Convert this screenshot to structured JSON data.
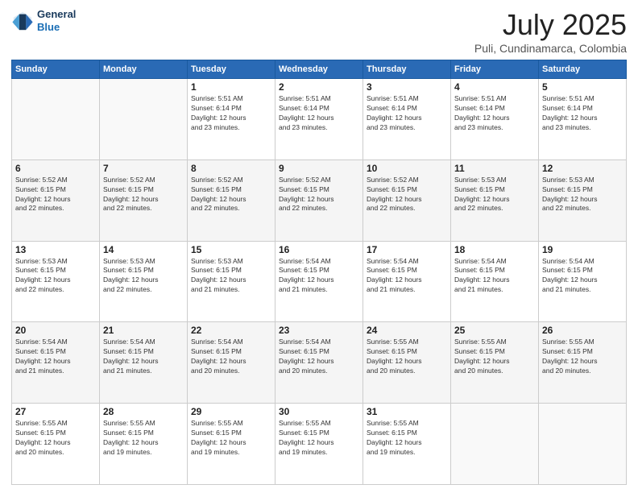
{
  "header": {
    "logo": {
      "line1": "General",
      "line2": "Blue"
    },
    "title": "July 2025",
    "subtitle": "Puli, Cundinamarca, Colombia"
  },
  "weekdays": [
    "Sunday",
    "Monday",
    "Tuesday",
    "Wednesday",
    "Thursday",
    "Friday",
    "Saturday"
  ],
  "weeks": [
    [
      {
        "day": "",
        "info": ""
      },
      {
        "day": "",
        "info": ""
      },
      {
        "day": "1",
        "sunrise": "5:51 AM",
        "sunset": "6:14 PM",
        "daylight": "12 hours and 23 minutes."
      },
      {
        "day": "2",
        "sunrise": "5:51 AM",
        "sunset": "6:14 PM",
        "daylight": "12 hours and 23 minutes."
      },
      {
        "day": "3",
        "sunrise": "5:51 AM",
        "sunset": "6:14 PM",
        "daylight": "12 hours and 23 minutes."
      },
      {
        "day": "4",
        "sunrise": "5:51 AM",
        "sunset": "6:14 PM",
        "daylight": "12 hours and 23 minutes."
      },
      {
        "day": "5",
        "sunrise": "5:51 AM",
        "sunset": "6:14 PM",
        "daylight": "12 hours and 23 minutes."
      }
    ],
    [
      {
        "day": "6",
        "sunrise": "5:52 AM",
        "sunset": "6:15 PM",
        "daylight": "12 hours and 22 minutes."
      },
      {
        "day": "7",
        "sunrise": "5:52 AM",
        "sunset": "6:15 PM",
        "daylight": "12 hours and 22 minutes."
      },
      {
        "day": "8",
        "sunrise": "5:52 AM",
        "sunset": "6:15 PM",
        "daylight": "12 hours and 22 minutes."
      },
      {
        "day": "9",
        "sunrise": "5:52 AM",
        "sunset": "6:15 PM",
        "daylight": "12 hours and 22 minutes."
      },
      {
        "day": "10",
        "sunrise": "5:52 AM",
        "sunset": "6:15 PM",
        "daylight": "12 hours and 22 minutes."
      },
      {
        "day": "11",
        "sunrise": "5:53 AM",
        "sunset": "6:15 PM",
        "daylight": "12 hours and 22 minutes."
      },
      {
        "day": "12",
        "sunrise": "5:53 AM",
        "sunset": "6:15 PM",
        "daylight": "12 hours and 22 minutes."
      }
    ],
    [
      {
        "day": "13",
        "sunrise": "5:53 AM",
        "sunset": "6:15 PM",
        "daylight": "12 hours and 22 minutes."
      },
      {
        "day": "14",
        "sunrise": "5:53 AM",
        "sunset": "6:15 PM",
        "daylight": "12 hours and 22 minutes."
      },
      {
        "day": "15",
        "sunrise": "5:53 AM",
        "sunset": "6:15 PM",
        "daylight": "12 hours and 21 minutes."
      },
      {
        "day": "16",
        "sunrise": "5:54 AM",
        "sunset": "6:15 PM",
        "daylight": "12 hours and 21 minutes."
      },
      {
        "day": "17",
        "sunrise": "5:54 AM",
        "sunset": "6:15 PM",
        "daylight": "12 hours and 21 minutes."
      },
      {
        "day": "18",
        "sunrise": "5:54 AM",
        "sunset": "6:15 PM",
        "daylight": "12 hours and 21 minutes."
      },
      {
        "day": "19",
        "sunrise": "5:54 AM",
        "sunset": "6:15 PM",
        "daylight": "12 hours and 21 minutes."
      }
    ],
    [
      {
        "day": "20",
        "sunrise": "5:54 AM",
        "sunset": "6:15 PM",
        "daylight": "12 hours and 21 minutes."
      },
      {
        "day": "21",
        "sunrise": "5:54 AM",
        "sunset": "6:15 PM",
        "daylight": "12 hours and 21 minutes."
      },
      {
        "day": "22",
        "sunrise": "5:54 AM",
        "sunset": "6:15 PM",
        "daylight": "12 hours and 20 minutes."
      },
      {
        "day": "23",
        "sunrise": "5:54 AM",
        "sunset": "6:15 PM",
        "daylight": "12 hours and 20 minutes."
      },
      {
        "day": "24",
        "sunrise": "5:55 AM",
        "sunset": "6:15 PM",
        "daylight": "12 hours and 20 minutes."
      },
      {
        "day": "25",
        "sunrise": "5:55 AM",
        "sunset": "6:15 PM",
        "daylight": "12 hours and 20 minutes."
      },
      {
        "day": "26",
        "sunrise": "5:55 AM",
        "sunset": "6:15 PM",
        "daylight": "12 hours and 20 minutes."
      }
    ],
    [
      {
        "day": "27",
        "sunrise": "5:55 AM",
        "sunset": "6:15 PM",
        "daylight": "12 hours and 20 minutes."
      },
      {
        "day": "28",
        "sunrise": "5:55 AM",
        "sunset": "6:15 PM",
        "daylight": "12 hours and 19 minutes."
      },
      {
        "day": "29",
        "sunrise": "5:55 AM",
        "sunset": "6:15 PM",
        "daylight": "12 hours and 19 minutes."
      },
      {
        "day": "30",
        "sunrise": "5:55 AM",
        "sunset": "6:15 PM",
        "daylight": "12 hours and 19 minutes."
      },
      {
        "day": "31",
        "sunrise": "5:55 AM",
        "sunset": "6:15 PM",
        "daylight": "12 hours and 19 minutes."
      },
      {
        "day": "",
        "info": ""
      },
      {
        "day": "",
        "info": ""
      }
    ]
  ],
  "labels": {
    "sunrise_prefix": "Sunrise: ",
    "sunset_prefix": "Sunset: ",
    "daylight_prefix": "Daylight: "
  }
}
